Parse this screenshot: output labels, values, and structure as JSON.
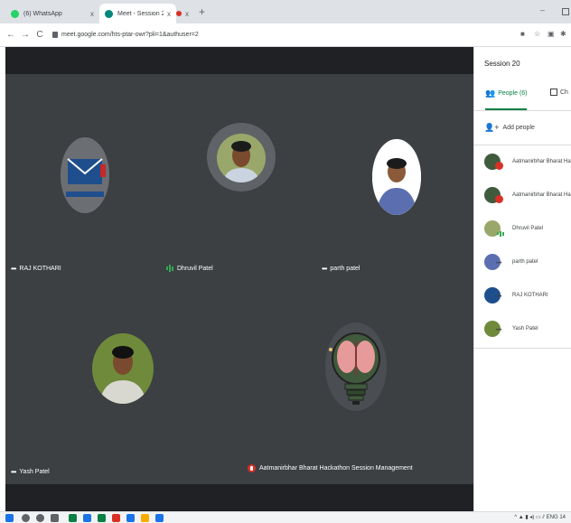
{
  "browser": {
    "tabs": [
      {
        "label": "(6) WhatsApp",
        "close": "x"
      },
      {
        "label": "Meet - Session 20",
        "close": "x"
      }
    ],
    "third_tab_close": "x",
    "new_tab": "+",
    "minimize": "–",
    "url": "meet.google.com/hts-ptar-owr?pli=1&authuser=2",
    "nav": {
      "back": "←",
      "forward": "→",
      "reload": "C"
    }
  },
  "meeting": {
    "tiles": [
      {
        "name": "RAJ KOTHARI",
        "status_icon": "more-dots"
      },
      {
        "name": "Dhruvil Patel",
        "status_icon": "speaking-equalizer"
      },
      {
        "name": "parth patel",
        "status_icon": "more-dots"
      },
      {
        "name": "Yash Patel",
        "status_icon": "more-dots"
      },
      {
        "name": "Aatmanirbhar Bharat Hackathon Session Management",
        "status_icon": "mic-off"
      }
    ],
    "dots": "•••"
  },
  "panel": {
    "title": "Session 20",
    "tabs": {
      "people": "People (6)",
      "chat": "Ch"
    },
    "add_people": "Add people",
    "participants": [
      {
        "name": "Aatmanirbhar Bharat Ha",
        "badge": "mic-off"
      },
      {
        "name": "Aatmanirbhar Bharat Ha",
        "badge": "mic-off"
      },
      {
        "name": "Dhruvil Patel",
        "badge": "speaking"
      },
      {
        "name": "parth patel",
        "badge": "more"
      },
      {
        "name": "RAJ KOTHARI",
        "badge": "more"
      },
      {
        "name": "Yash Patel",
        "badge": "more"
      }
    ]
  },
  "taskbar": {
    "tray_text": "ENG 14"
  },
  "colors": {
    "meet_green": "#0b8043",
    "mic_off_red": "#d93025",
    "stage_bg": "#3c4043",
    "stage_dark": "#202124"
  }
}
